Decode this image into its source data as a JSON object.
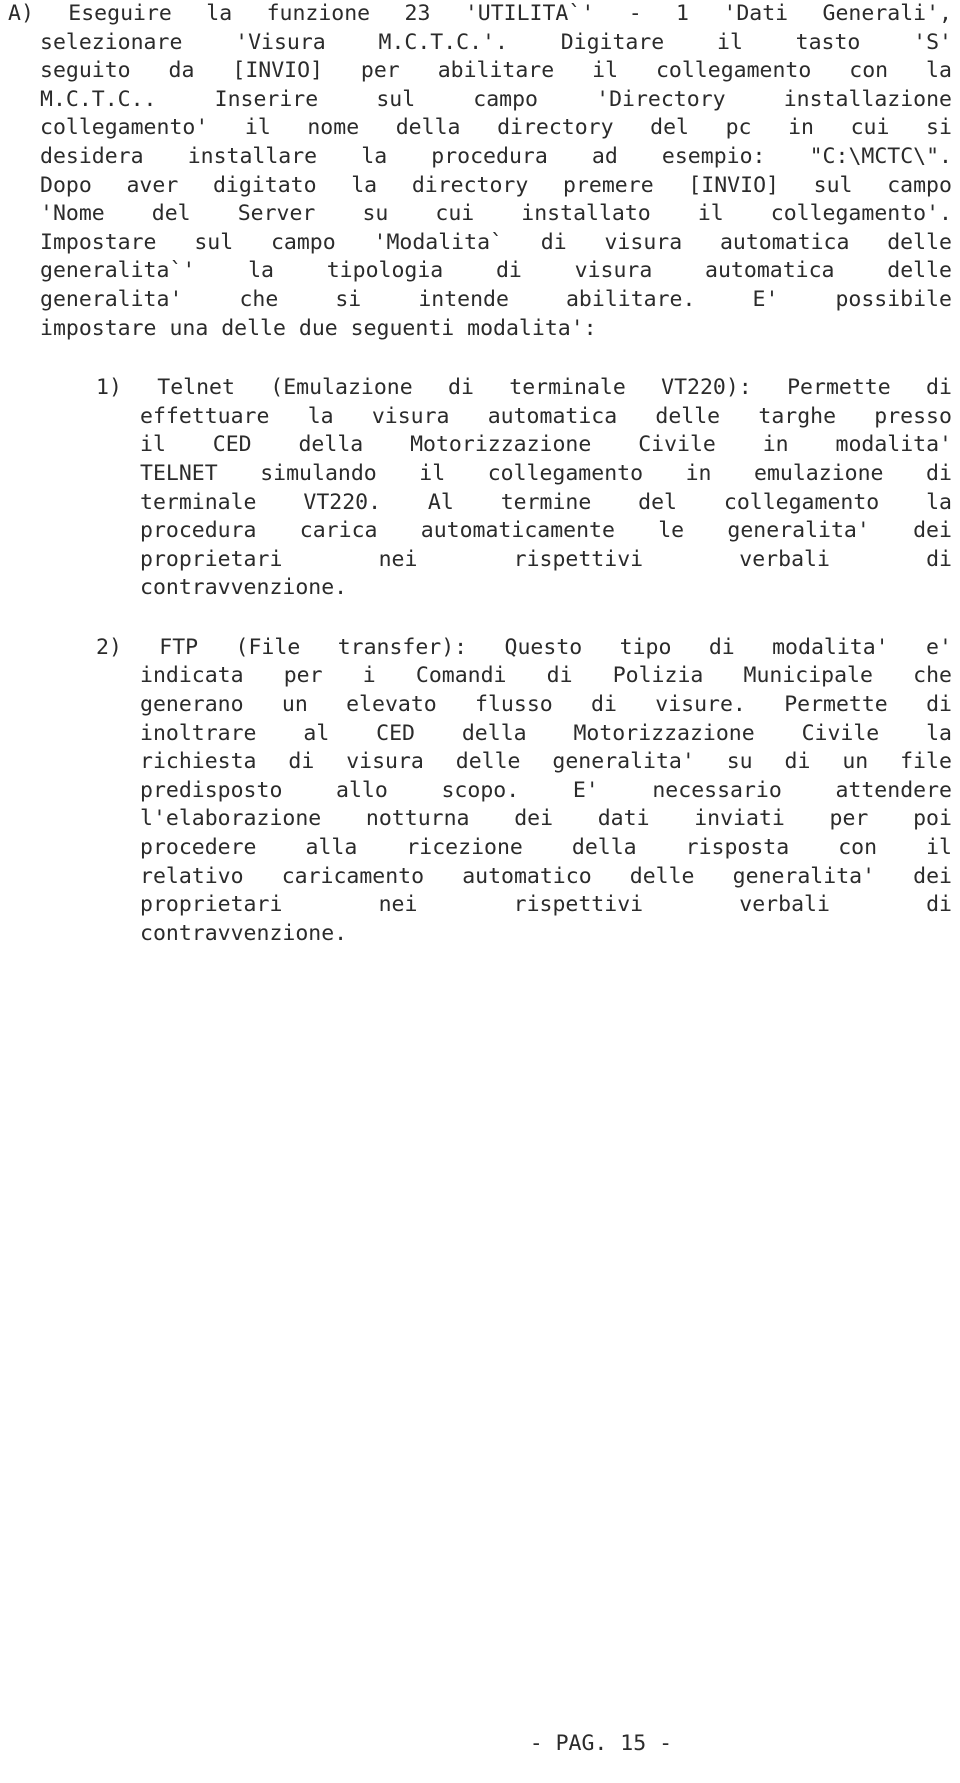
{
  "document": {
    "language": "it",
    "page_label": "- PAG. 15 -",
    "text_color": "#2b2b2b",
    "background_color": "#ffffff"
  },
  "blocks": [
    {
      "id": "block-a",
      "kind": "lettered-paragraph",
      "marker": "A)",
      "lines": [
        [
          "A)",
          "Eseguire",
          "la",
          "funzione",
          "23",
          "'UTILITA`'",
          "-",
          "1",
          "'Dati",
          "Generali',"
        ],
        [
          "selezionare",
          "'Visura",
          "M.C.T.C.'.",
          "Digitare",
          "il",
          "tasto",
          "'S'"
        ],
        [
          "seguito",
          "da",
          "[INVIO]",
          "per",
          "abilitare",
          "il",
          "collegamento",
          "con",
          "la"
        ],
        [
          "M.C.T.C..",
          "Inserire",
          "sul",
          "campo",
          "'Directory",
          "installazione"
        ],
        [
          "collegamento'",
          "il",
          "nome",
          "della",
          "directory",
          "del",
          "pc",
          "in",
          "cui",
          "si"
        ],
        [
          "desidera",
          "installare",
          "la",
          "procedura",
          "ad",
          "esempio:",
          "\"C:\\MCTC\\\"."
        ],
        [
          "Dopo",
          "aver",
          "digitato",
          "la",
          "directory",
          "premere",
          "[INVIO]",
          "sul",
          "campo"
        ],
        [
          "'Nome",
          "del",
          "Server",
          "su",
          "cui",
          "installato",
          "il",
          "collegamento'."
        ],
        [
          "Impostare",
          "sul",
          "campo",
          "'Modalita`",
          "di",
          "visura",
          "automatica",
          "delle"
        ],
        [
          "generalita`'",
          "la",
          "tipologia",
          "di",
          "visura",
          "automatica",
          "delle"
        ],
        [
          "generalita'",
          "che",
          "si",
          "intende",
          "abilitare.",
          "E'",
          "possibile"
        ],
        [
          "impostare una delle due seguenti modalita':"
        ]
      ],
      "last_line_flush": true
    },
    {
      "id": "list-item-1",
      "kind": "numbered-item",
      "marker": "1)",
      "title": "Telnet (Emulazione di terminale VT220)",
      "lines": [
        [
          "1)",
          "Telnet",
          "(Emulazione",
          "di",
          "terminale",
          "VT220):",
          "Permette",
          "di"
        ],
        [
          "effettuare",
          "la",
          "visura",
          "automatica",
          "delle",
          "targhe",
          "presso"
        ],
        [
          "il",
          "CED",
          "della",
          "Motorizzazione",
          "Civile",
          "in",
          "modalita'"
        ],
        [
          "TELNET",
          "simulando",
          "il",
          "collegamento",
          "in",
          "emulazione",
          "di"
        ],
        [
          "terminale",
          "VT220.",
          "Al",
          "termine",
          "del",
          "collegamento",
          "la"
        ],
        [
          "procedura",
          "carica",
          "automaticamente",
          "le",
          "generalita'",
          "dei"
        ],
        [
          "proprietari",
          "nei",
          "rispettivi",
          "verbali",
          "di"
        ],
        [
          "contravvenzione."
        ]
      ],
      "last_line_flush": true
    },
    {
      "id": "list-item-2",
      "kind": "numbered-item",
      "marker": "2)",
      "title": "FTP (File transfer)",
      "lines": [
        [
          "2)",
          "FTP",
          "(File",
          "transfer):",
          "Questo",
          "tipo",
          "di",
          "modalita'",
          "e'"
        ],
        [
          "indicata",
          "per",
          "i",
          "Comandi",
          "di",
          "Polizia",
          "Municipale",
          "che"
        ],
        [
          "generano",
          "un",
          "elevato",
          "flusso",
          "di",
          "visure.",
          "Permette",
          "di"
        ],
        [
          "inoltrare",
          "al",
          "CED",
          "della",
          "Motorizzazione",
          "Civile",
          "la"
        ],
        [
          "richiesta",
          "di",
          "visura",
          "delle",
          "generalita'",
          "su",
          "di",
          "un",
          "file"
        ],
        [
          "predisposto",
          "allo",
          "scopo.",
          "E'",
          "necessario",
          "attendere"
        ],
        [
          "l'elaborazione",
          "notturna",
          "dei",
          "dati",
          "inviati",
          "per",
          "poi"
        ],
        [
          "procedere",
          "alla",
          "ricezione",
          "della",
          "risposta",
          "con",
          "il"
        ],
        [
          "relativo",
          "caricamento",
          "automatico",
          "delle",
          "generalita'",
          "dei"
        ],
        [
          "proprietari",
          "nei",
          "rispettivi",
          "verbali",
          "di"
        ],
        [
          "contravvenzione."
        ]
      ],
      "last_line_flush": true
    }
  ],
  "footer": {
    "page_label": "- PAG. 15 -"
  }
}
